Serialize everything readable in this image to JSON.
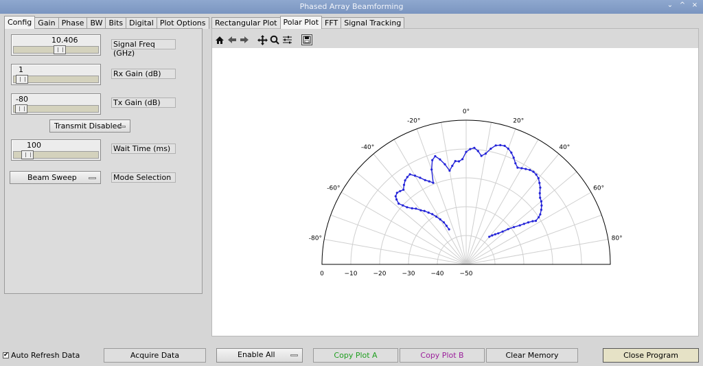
{
  "window": {
    "title": "Phased Array Beamforming",
    "controls": [
      "⌄",
      "^",
      "×"
    ]
  },
  "left_tabs": [
    "Config",
    "Gain",
    "Phase",
    "BW",
    "Bits",
    "Digital",
    "Plot Options"
  ],
  "right_tabs": [
    "Rectangular Plot",
    "Polar Plot",
    "FFT",
    "Signal Tracking"
  ],
  "config": {
    "signal_freq": {
      "value": "10.406",
      "label": "Signal Freq (GHz)",
      "level": 0.55
    },
    "rx_gain": {
      "value": "1",
      "label": "Rx Gain (dB)",
      "level": 0.03
    },
    "tx_gain": {
      "value": "-80",
      "label": "Tx Gain (dB)",
      "level": 0.02
    },
    "transmit": {
      "value": "Transmit Disabled"
    },
    "wait_time": {
      "value": "100",
      "label": "Wait Time (ms)",
      "level": 0.1
    },
    "mode": {
      "value": "Beam Sweep",
      "label": "Mode Selection"
    }
  },
  "toolbar_icons": [
    "home-icon",
    "back-arrow-icon",
    "forward-arrow-icon",
    "pan-icon",
    "zoom-icon",
    "configure-subplots-icon",
    "save-icon"
  ],
  "chart_data": {
    "type": "polar-line",
    "theta_range": [
      -90,
      90
    ],
    "r_ticks": [
      "0",
      "−10",
      "−20",
      "−30",
      "−40",
      "−50"
    ],
    "r_range": [
      -50,
      0
    ],
    "theta_ticks": [
      "-80°",
      "-60°",
      "-40°",
      "-20°",
      "0°",
      "20°",
      "40°",
      "60°",
      "80°"
    ],
    "series_color": "#2323d8",
    "series": [
      {
        "theta": [
          -26,
          -27,
          -28,
          -30,
          -32,
          -34,
          -36,
          -38,
          -40,
          -42,
          -44,
          -46,
          -47,
          -48,
          -47,
          -46,
          -44,
          -42,
          -40,
          -38,
          -36,
          -34,
          -32,
          -30,
          -28,
          -26,
          -24,
          -22,
          -20,
          -18,
          -16,
          -14,
          -12,
          -10,
          -8,
          -6,
          -4,
          -2,
          0,
          2,
          4,
          6,
          8,
          10,
          12,
          14,
          16,
          18,
          20,
          22,
          24,
          26,
          28,
          30,
          32,
          34,
          36,
          38,
          40,
          42,
          44,
          46,
          48,
          50,
          52,
          54,
          56,
          57,
          58,
          57,
          56,
          55,
          54,
          52,
          50,
          48,
          46,
          44,
          42,
          40
        ],
        "r": [
          -36.5,
          -35,
          -33.5,
          -32,
          -30.5,
          -29,
          -27.8,
          -26.5,
          -25.5,
          -24,
          -23,
          -21.5,
          -20,
          -18.5,
          -17,
          -16,
          -15.5,
          -15.8,
          -16.2,
          -15,
          -14,
          -13.5,
          -13.2,
          -14.5,
          -16,
          -17.5,
          -18.5,
          -19.5,
          -15,
          -12,
          -11,
          -12.5,
          -14.5,
          -17,
          -15.5,
          -14,
          -14.2,
          -13.5,
          -11,
          -10,
          -9.5,
          -10.5,
          -12,
          -11,
          -9,
          -7.5,
          -7,
          -6.8,
          -7.3,
          -8.2,
          -9.5,
          -11,
          -12,
          -11.5,
          -11,
          -10.5,
          -10.3,
          -10.5,
          -11,
          -12,
          -13,
          -14.5,
          -15.5,
          -16,
          -16.8,
          -17.8,
          -19,
          -20,
          -21.5,
          -22.5,
          -24,
          -25.5,
          -27,
          -29,
          -31,
          -33,
          -34.5,
          -35.5,
          -36.5,
          -37.5
        ]
      }
    ]
  },
  "bottom": {
    "auto_refresh": "Auto Refresh Data",
    "acquire": "Acquire Data",
    "enable_all": "Enable All",
    "copy_a": "Copy Plot A",
    "copy_b": "Copy Plot B",
    "clear": "Clear Memory",
    "close": "Close Program",
    "copy_a_color": "#1e9e1e",
    "copy_b_color": "#9b1e9b"
  }
}
